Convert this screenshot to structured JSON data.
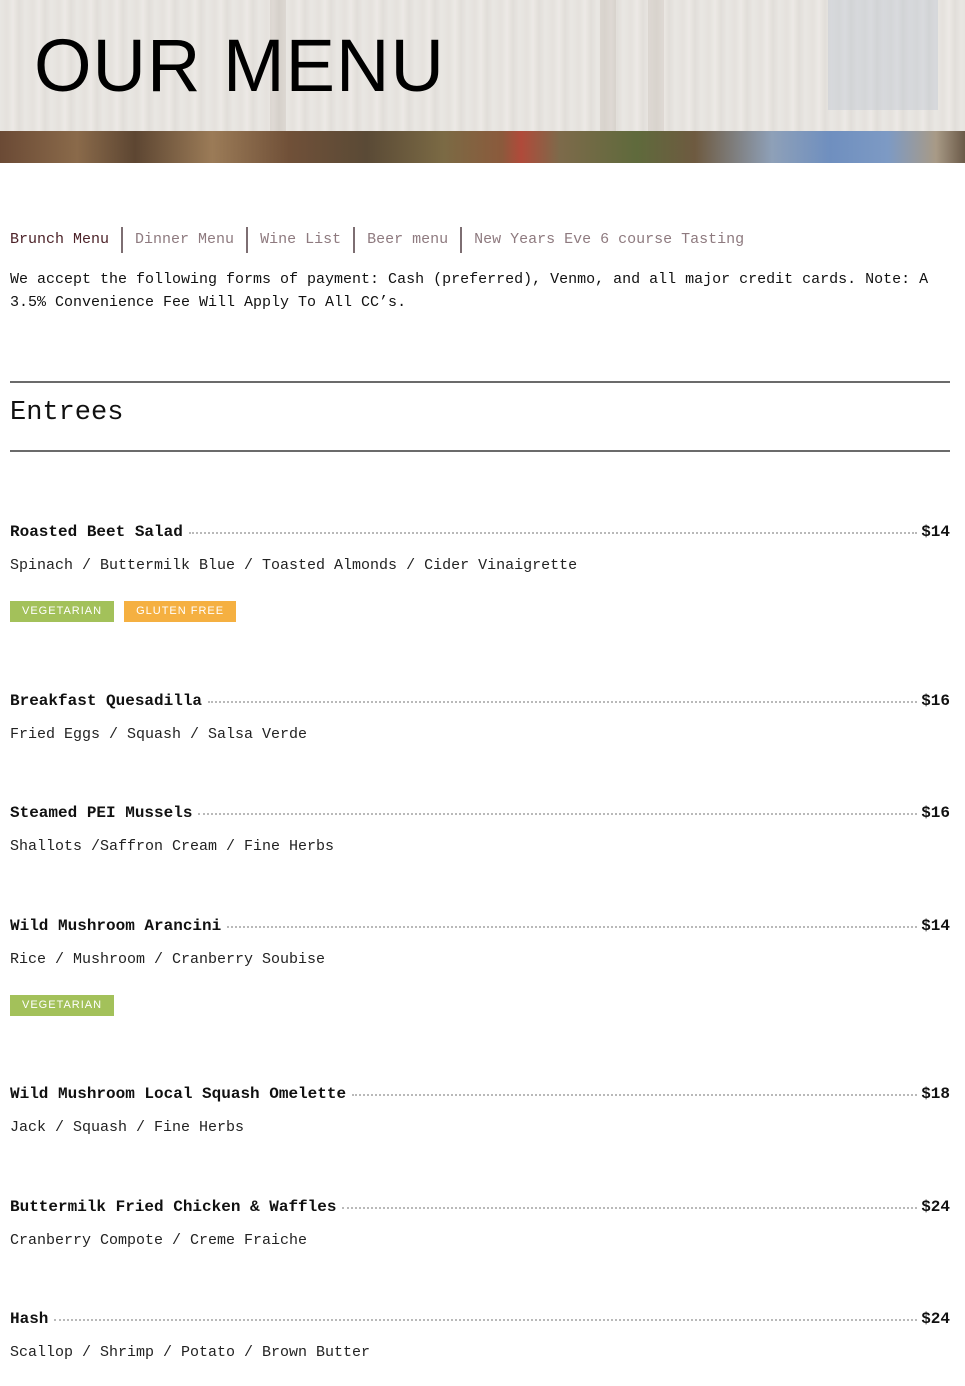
{
  "hero": {
    "title": "OUR MENU"
  },
  "tabs": [
    {
      "label": "Brunch Menu"
    },
    {
      "label": "Dinner Menu"
    },
    {
      "label": "Wine List"
    },
    {
      "label": "Beer menu"
    },
    {
      "label": "New Years Eve 6 course Tasting"
    }
  ],
  "payment_note": "We accept the following forms of payment: Cash (preferred), Venmo, and all major credit cards. Note: A 3.5% Convenience Fee Will Apply To All CC’s.",
  "section": {
    "title": "Entrees"
  },
  "colors": {
    "vegetarian": "#a3c15a",
    "gluten_free": "#f5b041",
    "active_tab": "#4c2228",
    "inactive_tab": "#8e7a7f"
  },
  "items": [
    {
      "name": "Roasted Beet Salad",
      "price": "$14",
      "desc": "Spinach / Buttermilk Blue / Toasted Almonds / Cider Vinaigrette",
      "tags": [
        "VEGETARIAN",
        "GLUTEN FREE"
      ]
    },
    {
      "name": "Breakfast Quesadilla",
      "price": "$16",
      "desc": "Fried Eggs / Squash / Salsa Verde"
    },
    {
      "name": "Steamed PEI Mussels",
      "price": "$16",
      "desc": "Shallots /Saffron Cream / Fine Herbs"
    },
    {
      "name": "Wild Mushroom Arancini",
      "price": "$14",
      "desc": "Rice / Mushroom / Cranberry Soubise",
      "tags": [
        "VEGETARIAN"
      ]
    },
    {
      "name": "Wild Mushroom Local Squash Omelette",
      "price": "$18",
      "desc": "Jack / Squash / Fine Herbs"
    },
    {
      "name": "Buttermilk Fried Chicken & Waffles",
      "price": "$24",
      "desc": "Cranberry Compote / Creme Fraiche"
    },
    {
      "name": "Hash",
      "price": "$24",
      "desc": "Scallop / Shrimp / Potato / Brown Butter"
    }
  ]
}
